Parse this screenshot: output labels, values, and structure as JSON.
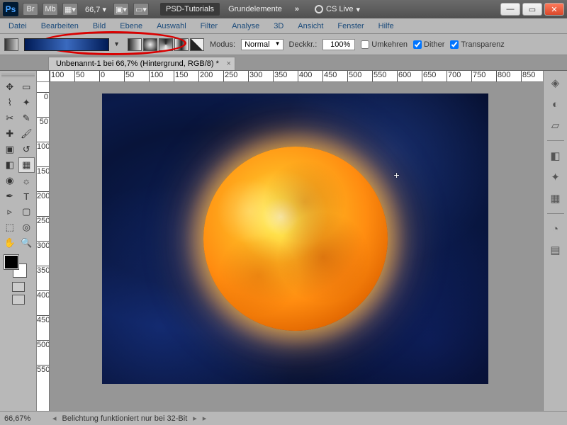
{
  "titlebar": {
    "app": "Ps",
    "zoom": "66,7",
    "workspace1": "PSD-Tutorials",
    "workspace2": "Grundelemente",
    "cslive": "CS Live"
  },
  "menu": [
    "Datei",
    "Bearbeiten",
    "Bild",
    "Ebene",
    "Auswahl",
    "Filter",
    "Analyse",
    "3D",
    "Ansicht",
    "Fenster",
    "Hilfe"
  ],
  "options": {
    "modus_label": "Modus:",
    "modus_value": "Normal",
    "deckkr_label": "Deckkr.:",
    "deckkr_value": "100%",
    "umkehren": "Umkehren",
    "dither": "Dither",
    "transparenz": "Transparenz"
  },
  "doctab": "Unbenannt-1 bei 66,7% (Hintergrund, RGB/8) *",
  "ruler_h": [
    "100",
    "50",
    "0",
    "50",
    "100",
    "150",
    "200",
    "250",
    "300",
    "350",
    "400",
    "450",
    "500",
    "550",
    "600",
    "650",
    "700",
    "750",
    "800",
    "850"
  ],
  "ruler_v": [
    "0",
    "50",
    "100",
    "150",
    "200",
    "250",
    "300",
    "350",
    "400",
    "450",
    "500",
    "550"
  ],
  "status": {
    "zoom": "66,67%",
    "msg": "Belichtung funktioniert nur bei 32-Bit"
  }
}
